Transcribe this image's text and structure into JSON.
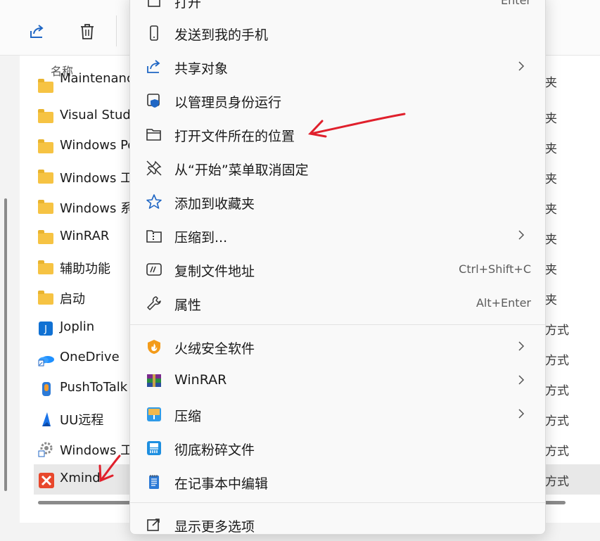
{
  "toolbar": {
    "share_icon": "share-icon",
    "delete_icon": "trash-icon"
  },
  "explorer": {
    "column_name": "名称",
    "rows": [
      {
        "name": "Maintenanc",
        "type": "夹",
        "icon": "folder-icon"
      },
      {
        "name": "Visual Stud",
        "type": "夹",
        "icon": "folder-icon"
      },
      {
        "name": "Windows Po",
        "type": "夹",
        "icon": "folder-icon"
      },
      {
        "name": "Windows 工",
        "type": "夹",
        "icon": "folder-icon"
      },
      {
        "name": "Windows 系",
        "type": "夹",
        "icon": "folder-icon"
      },
      {
        "name": "WinRAR",
        "type": "夹",
        "icon": "folder-icon"
      },
      {
        "name": "辅助功能",
        "type": "夹",
        "icon": "folder-icon"
      },
      {
        "name": "启动",
        "type": "夹",
        "icon": "folder-icon"
      },
      {
        "name": "Joplin",
        "type": "方式",
        "icon": "joplin-shortcut-icon"
      },
      {
        "name": "OneDrive",
        "type": "方式",
        "icon": "onedrive-shortcut-icon"
      },
      {
        "name": "PushToTalk",
        "type": "方式",
        "icon": "pushtotalk-shortcut-icon"
      },
      {
        "name": "UU远程",
        "type": "方式",
        "icon": "uu-shortcut-icon"
      },
      {
        "name": "Windows 工",
        "type": "方式",
        "icon": "windows-tools-shortcut-icon"
      },
      {
        "name": "Xmind",
        "type": "方式",
        "icon": "xmind-shortcut-icon"
      }
    ]
  },
  "menu": {
    "items": [
      {
        "label": "打开",
        "shortcut": "Enter",
        "icon": "open-icon"
      },
      {
        "label": "发送到我的手机",
        "icon": "phone-icon"
      },
      {
        "label": "共享对象",
        "icon": "share-icon",
        "arrow": true
      },
      {
        "label": "以管理员身份运行",
        "icon": "admin-shield-icon"
      },
      {
        "label": "打开文件所在的位置",
        "icon": "folder-open-icon"
      },
      {
        "label": "从“开始”菜单取消固定",
        "icon": "unpin-icon"
      },
      {
        "label": "添加到收藏夹",
        "icon": "star-icon"
      },
      {
        "label": "压缩到...",
        "icon": "zip-folder-icon",
        "arrow": true
      },
      {
        "label": "复制文件地址",
        "shortcut": "Ctrl+Shift+C",
        "icon": "copy-path-icon"
      },
      {
        "label": "属性",
        "shortcut": "Alt+Enter",
        "icon": "wrench-icon"
      },
      {
        "label": "火绒安全软件",
        "icon": "huorong-icon",
        "arrow": true
      },
      {
        "label": "WinRAR",
        "icon": "winrar-icon",
        "arrow": true
      },
      {
        "label": "压缩",
        "icon": "compress-icon",
        "arrow": true
      },
      {
        "label": "彻底粉碎文件",
        "icon": "shredder-icon"
      },
      {
        "label": "在记事本中编辑",
        "icon": "notepad-icon"
      },
      {
        "label": "显示更多选项",
        "icon": "more-options-icon"
      }
    ]
  },
  "colors": {
    "accent": "#0067c0",
    "annotation_arrow": "#e0202c",
    "folder": "#f6c343"
  }
}
